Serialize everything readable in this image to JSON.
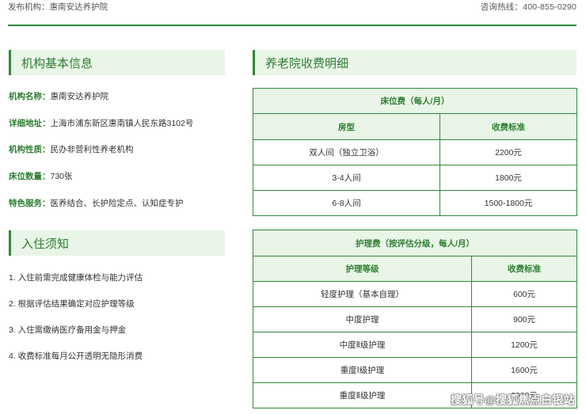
{
  "header": {
    "publisher_label": "发布机构：",
    "publisher_value": "惠南安达养护院",
    "hotline_label": "咨询热线：",
    "hotline_value": "400-855-0290"
  },
  "info": {
    "title": "机构基本信息",
    "rows": [
      {
        "key": "机构名称：",
        "value": "惠南安达养护院"
      },
      {
        "key": "详细地址：",
        "value": "上海市浦东新区惠南镇人民东路3102号"
      },
      {
        "key": "机构性质：",
        "value": "民办非营利性养老机构"
      },
      {
        "key": "床位数量：",
        "value": "730张"
      },
      {
        "key": "特色服务：",
        "value": "医养结合、长护险定点、认知症专护"
      }
    ]
  },
  "notice": {
    "title": "入住须知",
    "items": [
      "1. 入住前需完成健康体检与能力评估",
      "2. 根据评估结果确定对应护理等级",
      "3. 入住需缴纳医疗备用金与押金",
      "4. 收费标准每月公开透明无隐形消费"
    ]
  },
  "fees": {
    "title": "养老院收费明细",
    "bed": {
      "caption": "床位费（每人/月）",
      "headers": [
        "房型",
        "收费标准"
      ],
      "rows": [
        [
          "双人间（独立卫浴）",
          "2200元"
        ],
        [
          "3-4人间",
          "1800元"
        ],
        [
          "6-8人间",
          "1500-1800元"
        ]
      ]
    },
    "care": {
      "caption": "护理费（按评估分级，每人/月）",
      "headers": [
        "护理等级",
        "收费标准"
      ],
      "rows": [
        [
          "轻度护理（基本自理）",
          "600元"
        ],
        [
          "中度护理",
          "900元"
        ],
        [
          "中度Ⅱ级护理",
          "1200元"
        ],
        [
          "重度Ⅰ级护理",
          "1600元"
        ],
        [
          "重度Ⅱ级护理",
          "2000元"
        ]
      ]
    }
  },
  "watermark": "搜狐号@搜狐焦点白银站",
  "colors": {
    "accent": "#2e8b3a",
    "header_bg": "#e9f5e7"
  }
}
